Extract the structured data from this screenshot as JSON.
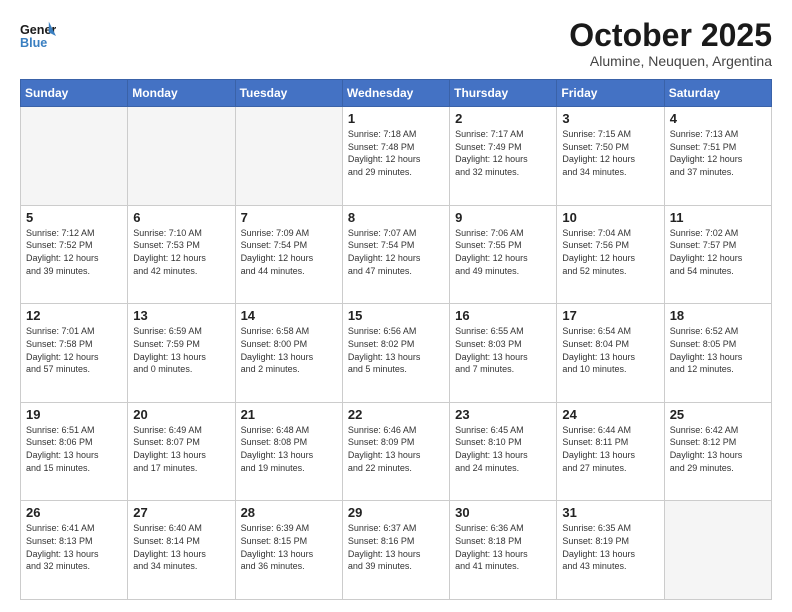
{
  "header": {
    "logo_general": "General",
    "logo_blue": "Blue",
    "month_title": "October 2025",
    "location": "Alumine, Neuquen, Argentina"
  },
  "days_of_week": [
    "Sunday",
    "Monday",
    "Tuesday",
    "Wednesday",
    "Thursday",
    "Friday",
    "Saturday"
  ],
  "weeks": [
    [
      {
        "day": "",
        "info": ""
      },
      {
        "day": "",
        "info": ""
      },
      {
        "day": "",
        "info": ""
      },
      {
        "day": "1",
        "info": "Sunrise: 7:18 AM\nSunset: 7:48 PM\nDaylight: 12 hours\nand 29 minutes."
      },
      {
        "day": "2",
        "info": "Sunrise: 7:17 AM\nSunset: 7:49 PM\nDaylight: 12 hours\nand 32 minutes."
      },
      {
        "day": "3",
        "info": "Sunrise: 7:15 AM\nSunset: 7:50 PM\nDaylight: 12 hours\nand 34 minutes."
      },
      {
        "day": "4",
        "info": "Sunrise: 7:13 AM\nSunset: 7:51 PM\nDaylight: 12 hours\nand 37 minutes."
      }
    ],
    [
      {
        "day": "5",
        "info": "Sunrise: 7:12 AM\nSunset: 7:52 PM\nDaylight: 12 hours\nand 39 minutes."
      },
      {
        "day": "6",
        "info": "Sunrise: 7:10 AM\nSunset: 7:53 PM\nDaylight: 12 hours\nand 42 minutes."
      },
      {
        "day": "7",
        "info": "Sunrise: 7:09 AM\nSunset: 7:54 PM\nDaylight: 12 hours\nand 44 minutes."
      },
      {
        "day": "8",
        "info": "Sunrise: 7:07 AM\nSunset: 7:54 PM\nDaylight: 12 hours\nand 47 minutes."
      },
      {
        "day": "9",
        "info": "Sunrise: 7:06 AM\nSunset: 7:55 PM\nDaylight: 12 hours\nand 49 minutes."
      },
      {
        "day": "10",
        "info": "Sunrise: 7:04 AM\nSunset: 7:56 PM\nDaylight: 12 hours\nand 52 minutes."
      },
      {
        "day": "11",
        "info": "Sunrise: 7:02 AM\nSunset: 7:57 PM\nDaylight: 12 hours\nand 54 minutes."
      }
    ],
    [
      {
        "day": "12",
        "info": "Sunrise: 7:01 AM\nSunset: 7:58 PM\nDaylight: 12 hours\nand 57 minutes."
      },
      {
        "day": "13",
        "info": "Sunrise: 6:59 AM\nSunset: 7:59 PM\nDaylight: 13 hours\nand 0 minutes."
      },
      {
        "day": "14",
        "info": "Sunrise: 6:58 AM\nSunset: 8:00 PM\nDaylight: 13 hours\nand 2 minutes."
      },
      {
        "day": "15",
        "info": "Sunrise: 6:56 AM\nSunset: 8:02 PM\nDaylight: 13 hours\nand 5 minutes."
      },
      {
        "day": "16",
        "info": "Sunrise: 6:55 AM\nSunset: 8:03 PM\nDaylight: 13 hours\nand 7 minutes."
      },
      {
        "day": "17",
        "info": "Sunrise: 6:54 AM\nSunset: 8:04 PM\nDaylight: 13 hours\nand 10 minutes."
      },
      {
        "day": "18",
        "info": "Sunrise: 6:52 AM\nSunset: 8:05 PM\nDaylight: 13 hours\nand 12 minutes."
      }
    ],
    [
      {
        "day": "19",
        "info": "Sunrise: 6:51 AM\nSunset: 8:06 PM\nDaylight: 13 hours\nand 15 minutes."
      },
      {
        "day": "20",
        "info": "Sunrise: 6:49 AM\nSunset: 8:07 PM\nDaylight: 13 hours\nand 17 minutes."
      },
      {
        "day": "21",
        "info": "Sunrise: 6:48 AM\nSunset: 8:08 PM\nDaylight: 13 hours\nand 19 minutes."
      },
      {
        "day": "22",
        "info": "Sunrise: 6:46 AM\nSunset: 8:09 PM\nDaylight: 13 hours\nand 22 minutes."
      },
      {
        "day": "23",
        "info": "Sunrise: 6:45 AM\nSunset: 8:10 PM\nDaylight: 13 hours\nand 24 minutes."
      },
      {
        "day": "24",
        "info": "Sunrise: 6:44 AM\nSunset: 8:11 PM\nDaylight: 13 hours\nand 27 minutes."
      },
      {
        "day": "25",
        "info": "Sunrise: 6:42 AM\nSunset: 8:12 PM\nDaylight: 13 hours\nand 29 minutes."
      }
    ],
    [
      {
        "day": "26",
        "info": "Sunrise: 6:41 AM\nSunset: 8:13 PM\nDaylight: 13 hours\nand 32 minutes."
      },
      {
        "day": "27",
        "info": "Sunrise: 6:40 AM\nSunset: 8:14 PM\nDaylight: 13 hours\nand 34 minutes."
      },
      {
        "day": "28",
        "info": "Sunrise: 6:39 AM\nSunset: 8:15 PM\nDaylight: 13 hours\nand 36 minutes."
      },
      {
        "day": "29",
        "info": "Sunrise: 6:37 AM\nSunset: 8:16 PM\nDaylight: 13 hours\nand 39 minutes."
      },
      {
        "day": "30",
        "info": "Sunrise: 6:36 AM\nSunset: 8:18 PM\nDaylight: 13 hours\nand 41 minutes."
      },
      {
        "day": "31",
        "info": "Sunrise: 6:35 AM\nSunset: 8:19 PM\nDaylight: 13 hours\nand 43 minutes."
      },
      {
        "day": "",
        "info": ""
      }
    ]
  ]
}
